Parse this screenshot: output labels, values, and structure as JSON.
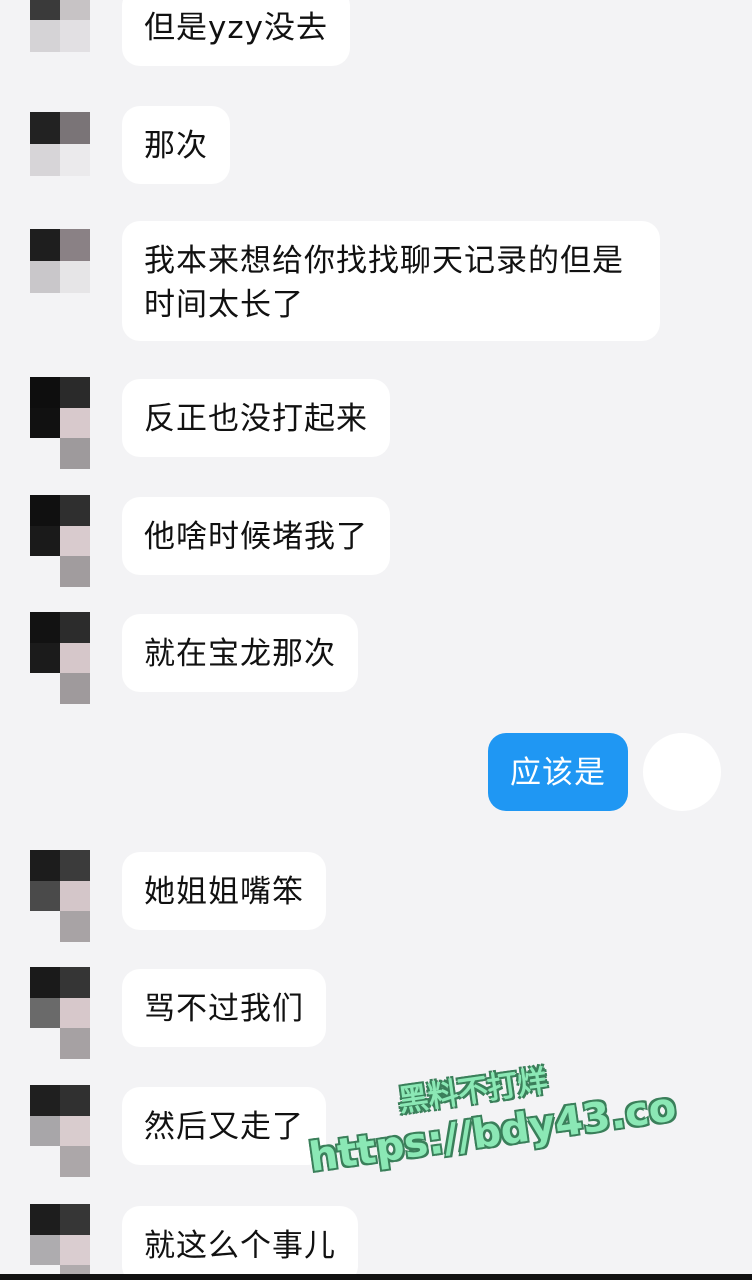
{
  "messages": [
    {
      "from": "other",
      "text": "但是yzy没去"
    },
    {
      "from": "other",
      "text": "那次"
    },
    {
      "from": "other",
      "text": "我本来想给你找找聊天记录的但是\n时间太长了"
    },
    {
      "from": "other",
      "text": "反正也没打起来"
    },
    {
      "from": "other",
      "text": "他啥时候堵我了"
    },
    {
      "from": "other",
      "text": "就在宝龙那次"
    },
    {
      "from": "self",
      "text": "应该是"
    },
    {
      "from": "other",
      "text": "她姐姐嘴笨"
    },
    {
      "from": "other",
      "text": "骂不过我们"
    },
    {
      "from": "other",
      "text": "然后又走了"
    },
    {
      "from": "other",
      "text": "就这么个事儿"
    }
  ],
  "watermark": {
    "line1": "黑料不打烊",
    "line2": "https://bdy43.co"
  },
  "colors": {
    "background": "#f3f3f5",
    "bubble_other": "#ffffff",
    "bubble_self": "#1f97f3"
  }
}
